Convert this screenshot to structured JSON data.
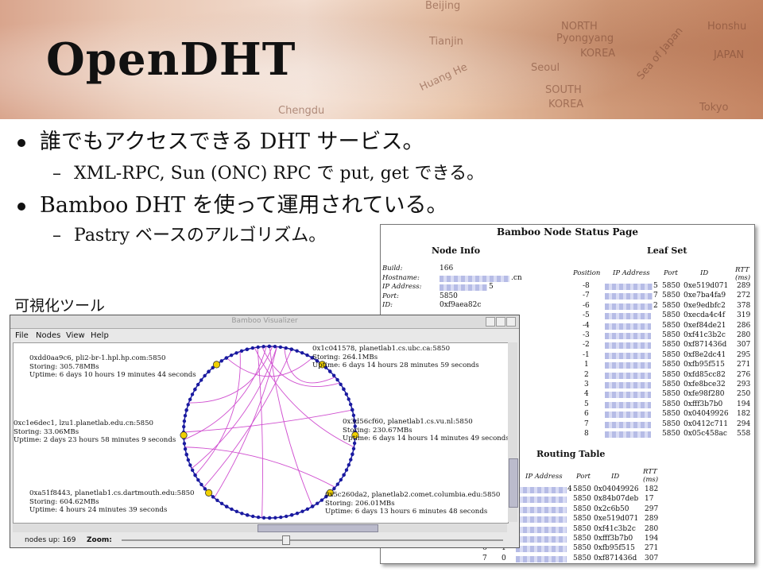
{
  "slide": {
    "title": "OpenDHT",
    "bullets": [
      {
        "text": "誰でもアクセスできる DHT サービス。",
        "sub": "XML-RPC, Sun (ONC) RPC で put, get できる。"
      },
      {
        "text": "Bamboo DHT を使って運用されている。",
        "sub": "Pastry ベースのアルゴリズム。"
      }
    ],
    "visualizer_caption": "可視化ツール",
    "map_labels": [
      "Beijing",
      "Tianjin",
      "NORTH",
      "Pyongyang",
      "KOREA",
      "Seoul",
      "SOUTH",
      "KOREA",
      "Sea of Japan",
      "JAPAN",
      "Honshu",
      "Tokyo",
      "Huang He",
      "Chengdu"
    ]
  },
  "status_page": {
    "title": "Bamboo Node Status Page",
    "node_info": {
      "heading": "Node Info",
      "rows": [
        {
          "label": "Build:",
          "value": "166"
        },
        {
          "label": "Hostname:",
          "value": ".cn"
        },
        {
          "label": "IP Address:",
          "value": "5"
        },
        {
          "label": "Port:",
          "value": "5850"
        },
        {
          "label": "ID:",
          "value": "0xf9aea82c"
        }
      ]
    },
    "leaf_set": {
      "heading": "Leaf Set",
      "columns": [
        "Position",
        "IP Address",
        "Port",
        "ID",
        "RTT (ms)"
      ],
      "rows": [
        [
          "-8",
          "5",
          "5850",
          "0xe519d071",
          "289"
        ],
        [
          "-7",
          "7",
          "5850",
          "0xe7ba4fa9",
          "272"
        ],
        [
          "-6",
          "2",
          "5850",
          "0xe9edbfc2",
          "378"
        ],
        [
          "-5",
          "",
          "5850",
          "0xecda4c4f",
          "319"
        ],
        [
          "-4",
          "",
          "5850",
          "0xef84de21",
          "286"
        ],
        [
          "-3",
          "",
          "5850",
          "0xf41c3b2c",
          "280"
        ],
        [
          "-2",
          "",
          "5850",
          "0xf871436d",
          "307"
        ],
        [
          "-1",
          "",
          "5850",
          "0xf8e2dc41",
          "295"
        ],
        [
          "1",
          "",
          "5850",
          "0xfb95f515",
          "271"
        ],
        [
          "2",
          "",
          "5850",
          "0xfd85cc82",
          "276"
        ],
        [
          "3",
          "",
          "5850",
          "0xfe8bce32",
          "293"
        ],
        [
          "4",
          "",
          "5850",
          "0xfe98f280",
          "250"
        ],
        [
          "5",
          "",
          "5850",
          "0xfff3b7b0",
          "194"
        ],
        [
          "6",
          "",
          "5850",
          "0x04049926",
          "182"
        ],
        [
          "7",
          "",
          "5850",
          "0x0412c711",
          "294"
        ],
        [
          "8",
          "",
          "5850",
          "0x05c458ac",
          "558"
        ]
      ]
    },
    "routing_table": {
      "heading": "Routing Table",
      "columns": [
        "IP Address",
        "Port",
        "ID",
        "RTT (ms)"
      ],
      "rows": [
        [
          "4",
          "5850",
          "0x04049926",
          "182"
        ],
        [
          "",
          "5850",
          "0x84b07deb",
          "17"
        ],
        [
          "",
          "5850",
          "0x2c6b50",
          "297"
        ],
        [
          "",
          "5850",
          "0xe519d071",
          "289"
        ],
        [
          "",
          "5850",
          "0xf41c3b2c",
          "280"
        ],
        [
          "",
          "5850",
          "0xfff3b7b0",
          "194"
        ],
        [
          "",
          "5850",
          "0xfb95f515",
          "271"
        ],
        [
          "",
          "5850",
          "0xf871436d",
          "307"
        ]
      ],
      "row_indices": [
        [
          "6",
          "1"
        ],
        [
          "7",
          "0"
        ]
      ]
    }
  },
  "visualizer": {
    "window_title": "Bamboo Visualizer",
    "menus": [
      "File",
      "Nodes",
      "View",
      "Help"
    ],
    "nodes": [
      {
        "id": "0xdd0aa9c6, pli2-br-1.hpl.hp.com:5850",
        "storing": "Storing: 305.78MBs",
        "uptime": "Uptime: 6 days 10 hours 19 minutes 44 seconds"
      },
      {
        "id": "0x1c041578, planetlab1.cs.ubc.ca:5850",
        "storing": "Storing: 264.1MBs",
        "uptime": "Uptime: 6 days 14 hours 28 minutes 59 seconds"
      },
      {
        "id": "0xc1e6dec1, lzu1.planetlab.edu.cn:5850",
        "storing": "Storing: 33.06MBs",
        "uptime": "Uptime: 2 days 23 hours 58 minutes 9 seconds"
      },
      {
        "id": "0x3d56cf60, planetlab1.cs.vu.nl:5850",
        "storing": "Storing: 230.67MBs",
        "uptime": "Uptime: 6 days 14 hours 14 minutes 49 seconds"
      },
      {
        "id": "0xa51f8443, planetlab1.cs.dartmouth.edu:5850",
        "storing": "Storing: 604.62MBs",
        "uptime": "Uptime: 4 hours 24 minutes 39 seconds"
      },
      {
        "id": "0x5c260da2, planetlab2.comet.columbia.edu:5850",
        "storing": "Storing: 206.01MBs",
        "uptime": "Uptime: 6 days 13 hours 6 minutes 48 seconds"
      }
    ],
    "status": {
      "nodes_up": "nodes up: 169",
      "zoom_label": "Zoom:"
    },
    "colors": {
      "ring": "#1a1aa0",
      "highlight": "#f0d000",
      "links": "#d050d0"
    }
  }
}
